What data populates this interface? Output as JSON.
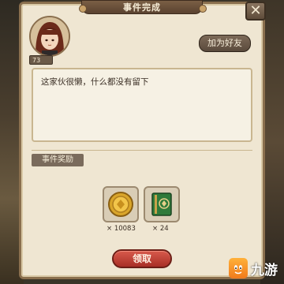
{
  "dialog": {
    "title": "事件完成",
    "close_label": "✕"
  },
  "player": {
    "level": "73",
    "add_friend_label": "加为好友",
    "message": "这家伙很懒，什么都没有留下"
  },
  "rewards": {
    "section_label": "事件奖励",
    "items": [
      {
        "icon": "gold-coin-icon",
        "count": "× 10083"
      },
      {
        "icon": "green-book-icon",
        "count": "× 24"
      }
    ]
  },
  "claim_label": "领取",
  "watermark": {
    "text": "九游"
  },
  "colors": {
    "panel": "#efe6d2",
    "frame": "#8a6f4e",
    "claim": "#c4413a"
  }
}
